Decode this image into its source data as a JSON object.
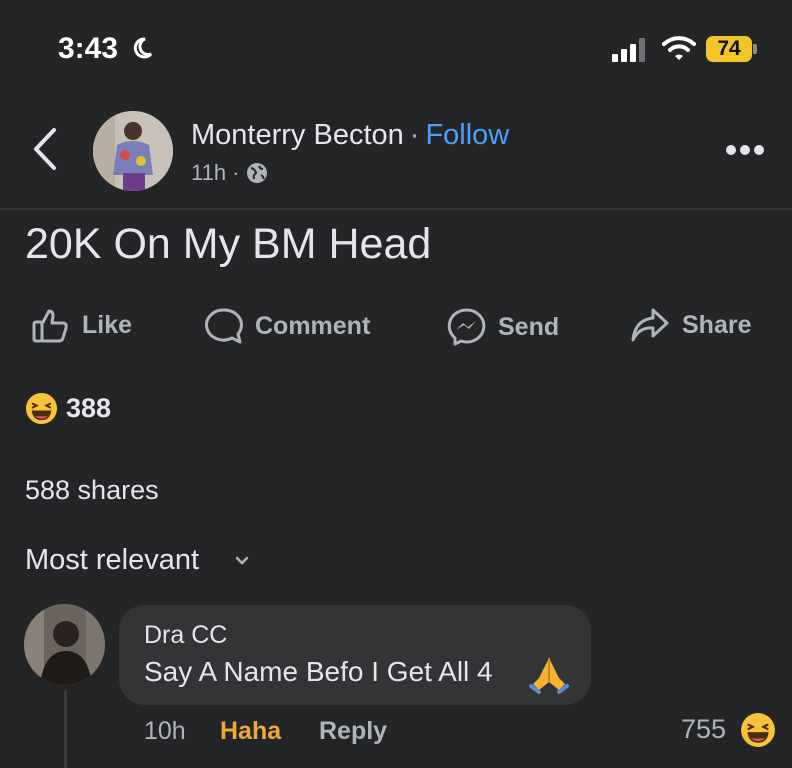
{
  "status_bar": {
    "time": "3:43",
    "battery": "74"
  },
  "post": {
    "author": "Monterry Becton",
    "separator": "·",
    "follow_label": "Follow",
    "time_ago": "11h ·",
    "text": "20K On My BM Head",
    "actions": {
      "like": "Like",
      "comment": "Comment",
      "send": "Send",
      "share": "Share"
    },
    "reaction_count": "388",
    "shares": "588 shares"
  },
  "comments_section": {
    "sort_label": "Most relevant"
  },
  "comment": {
    "author": "Dra CC",
    "text": "Say A Name Befo I Get All 4",
    "time": "10h",
    "reaction_label": "Haha",
    "reply_label": "Reply",
    "reaction_count": "755"
  },
  "colors": {
    "background": "#242527",
    "follow_link": "#4c9ef7",
    "haha": "#f0a73a",
    "battery": "#f2c52b"
  },
  "icons": [
    "moon-icon",
    "signal-icon",
    "wifi-icon",
    "back-icon",
    "globe-icon",
    "more-icon",
    "like-icon",
    "comment-icon",
    "messenger-icon",
    "share-icon",
    "haha-emoji-icon",
    "chevron-down-icon",
    "pray-icon"
  ]
}
